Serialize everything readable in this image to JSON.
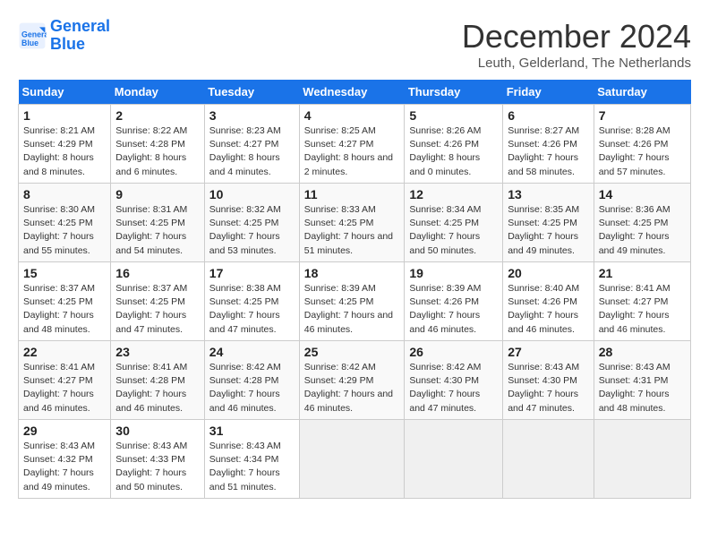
{
  "header": {
    "logo_line1": "General",
    "logo_line2": "Blue",
    "title": "December 2024",
    "subtitle": "Leuth, Gelderland, The Netherlands"
  },
  "columns": [
    "Sunday",
    "Monday",
    "Tuesday",
    "Wednesday",
    "Thursday",
    "Friday",
    "Saturday"
  ],
  "weeks": [
    [
      {
        "day": "1",
        "sunrise": "8:21 AM",
        "sunset": "4:29 PM",
        "daylight": "8 hours and 8 minutes."
      },
      {
        "day": "2",
        "sunrise": "8:22 AM",
        "sunset": "4:28 PM",
        "daylight": "8 hours and 6 minutes."
      },
      {
        "day": "3",
        "sunrise": "8:23 AM",
        "sunset": "4:27 PM",
        "daylight": "8 hours and 4 minutes."
      },
      {
        "day": "4",
        "sunrise": "8:25 AM",
        "sunset": "4:27 PM",
        "daylight": "8 hours and 2 minutes."
      },
      {
        "day": "5",
        "sunrise": "8:26 AM",
        "sunset": "4:26 PM",
        "daylight": "8 hours and 0 minutes."
      },
      {
        "day": "6",
        "sunrise": "8:27 AM",
        "sunset": "4:26 PM",
        "daylight": "7 hours and 58 minutes."
      },
      {
        "day": "7",
        "sunrise": "8:28 AM",
        "sunset": "4:26 PM",
        "daylight": "7 hours and 57 minutes."
      }
    ],
    [
      {
        "day": "8",
        "sunrise": "8:30 AM",
        "sunset": "4:25 PM",
        "daylight": "7 hours and 55 minutes."
      },
      {
        "day": "9",
        "sunrise": "8:31 AM",
        "sunset": "4:25 PM",
        "daylight": "7 hours and 54 minutes."
      },
      {
        "day": "10",
        "sunrise": "8:32 AM",
        "sunset": "4:25 PM",
        "daylight": "7 hours and 53 minutes."
      },
      {
        "day": "11",
        "sunrise": "8:33 AM",
        "sunset": "4:25 PM",
        "daylight": "7 hours and 51 minutes."
      },
      {
        "day": "12",
        "sunrise": "8:34 AM",
        "sunset": "4:25 PM",
        "daylight": "7 hours and 50 minutes."
      },
      {
        "day": "13",
        "sunrise": "8:35 AM",
        "sunset": "4:25 PM",
        "daylight": "7 hours and 49 minutes."
      },
      {
        "day": "14",
        "sunrise": "8:36 AM",
        "sunset": "4:25 PM",
        "daylight": "7 hours and 49 minutes."
      }
    ],
    [
      {
        "day": "15",
        "sunrise": "8:37 AM",
        "sunset": "4:25 PM",
        "daylight": "7 hours and 48 minutes."
      },
      {
        "day": "16",
        "sunrise": "8:37 AM",
        "sunset": "4:25 PM",
        "daylight": "7 hours and 47 minutes."
      },
      {
        "day": "17",
        "sunrise": "8:38 AM",
        "sunset": "4:25 PM",
        "daylight": "7 hours and 47 minutes."
      },
      {
        "day": "18",
        "sunrise": "8:39 AM",
        "sunset": "4:25 PM",
        "daylight": "7 hours and 46 minutes."
      },
      {
        "day": "19",
        "sunrise": "8:39 AM",
        "sunset": "4:26 PM",
        "daylight": "7 hours and 46 minutes."
      },
      {
        "day": "20",
        "sunrise": "8:40 AM",
        "sunset": "4:26 PM",
        "daylight": "7 hours and 46 minutes."
      },
      {
        "day": "21",
        "sunrise": "8:41 AM",
        "sunset": "4:27 PM",
        "daylight": "7 hours and 46 minutes."
      }
    ],
    [
      {
        "day": "22",
        "sunrise": "8:41 AM",
        "sunset": "4:27 PM",
        "daylight": "7 hours and 46 minutes."
      },
      {
        "day": "23",
        "sunrise": "8:41 AM",
        "sunset": "4:28 PM",
        "daylight": "7 hours and 46 minutes."
      },
      {
        "day": "24",
        "sunrise": "8:42 AM",
        "sunset": "4:28 PM",
        "daylight": "7 hours and 46 minutes."
      },
      {
        "day": "25",
        "sunrise": "8:42 AM",
        "sunset": "4:29 PM",
        "daylight": "7 hours and 46 minutes."
      },
      {
        "day": "26",
        "sunrise": "8:42 AM",
        "sunset": "4:30 PM",
        "daylight": "7 hours and 47 minutes."
      },
      {
        "day": "27",
        "sunrise": "8:43 AM",
        "sunset": "4:30 PM",
        "daylight": "7 hours and 47 minutes."
      },
      {
        "day": "28",
        "sunrise": "8:43 AM",
        "sunset": "4:31 PM",
        "daylight": "7 hours and 48 minutes."
      }
    ],
    [
      {
        "day": "29",
        "sunrise": "8:43 AM",
        "sunset": "4:32 PM",
        "daylight": "7 hours and 49 minutes."
      },
      {
        "day": "30",
        "sunrise": "8:43 AM",
        "sunset": "4:33 PM",
        "daylight": "7 hours and 50 minutes."
      },
      {
        "day": "31",
        "sunrise": "8:43 AM",
        "sunset": "4:34 PM",
        "daylight": "7 hours and 51 minutes."
      },
      null,
      null,
      null,
      null
    ]
  ]
}
